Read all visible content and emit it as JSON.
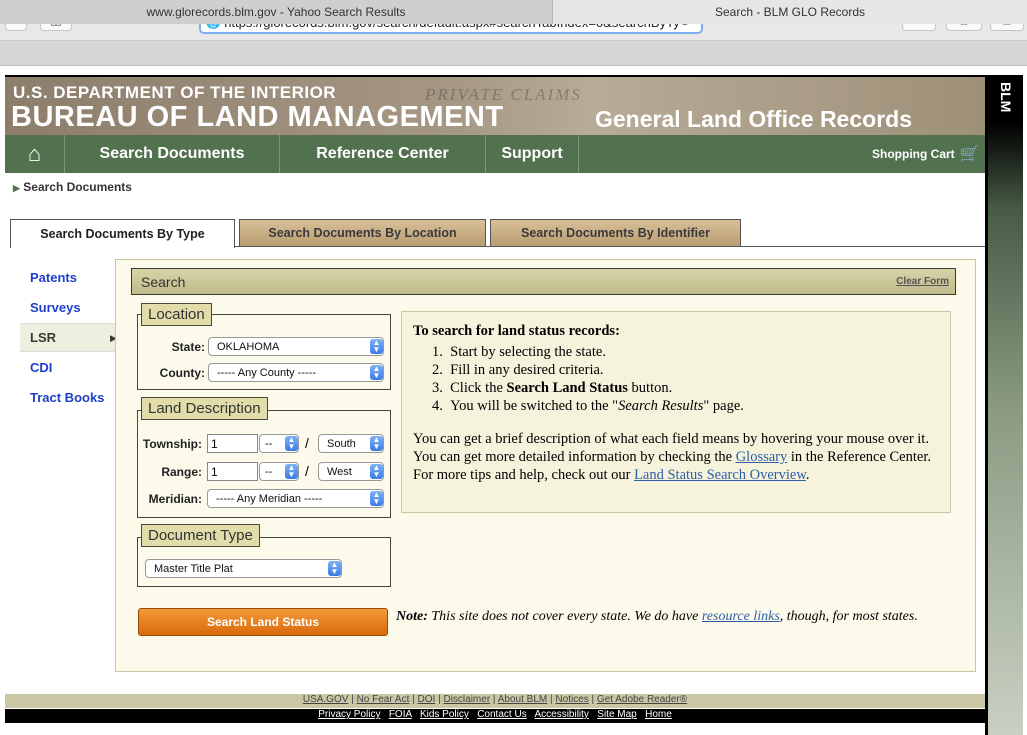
{
  "browser": {
    "url": "https://glorecords.blm.gov/search/default.aspx#searchTabIndex=0&searchByTy",
    "tabs": [
      "www.glorecords.blm.gov - Yahoo Search Results",
      "Search - BLM GLO Records"
    ]
  },
  "header": {
    "dept": "U.S. DEPARTMENT OF THE INTERIOR",
    "bureau": "BUREAU OF LAND MANAGEMENT",
    "deco": "PRIVATE CLAIMS",
    "glo": "General Land Office Records",
    "side": "BLM"
  },
  "nav": {
    "items": [
      "Search Documents",
      "Reference Center",
      "Support"
    ],
    "cart": "Shopping Cart"
  },
  "breadcrumb": "Search Documents",
  "search_tabs": [
    "Search Documents By Type",
    "Search Documents By Location",
    "Search Documents By Identifier"
  ],
  "sidebar": [
    "Patents",
    "Surveys",
    "LSR",
    "CDI",
    "Tract Books"
  ],
  "panel": {
    "title": "Search",
    "clear": "Clear Form",
    "location": {
      "legend": "Location",
      "state_label": "State:",
      "state_value": "OKLAHOMA",
      "county_label": "County:",
      "county_value": "----- Any County -----"
    },
    "land": {
      "legend": "Land Description",
      "township_label": "Township:",
      "township_value": "1",
      "township_dir": "--",
      "township_ns": "South",
      "range_label": "Range:",
      "range_value": "1",
      "range_dir": "--",
      "range_ew": "West",
      "slash": "/",
      "meridian_label": "Meridian:",
      "meridian_value": "----- Any Meridian -----"
    },
    "doctype": {
      "legend": "Document Type",
      "value": "Master Title Plat"
    },
    "button": "Search Land Status"
  },
  "info": {
    "heading": "To search for land status records:",
    "step1": "Start by selecting the state.",
    "step2": "Fill in any desired criteria.",
    "step3_a": "Click the ",
    "step3_b": "Search Land Status",
    "step3_c": " button.",
    "step4_a": "You will be switched to the \"",
    "step4_b": "Search Results",
    "step4_c": "\" page.",
    "para_a": "You can get a brief description of what each field means by hovering your mouse over it. You can get more detailed information by checking the ",
    "para_glossary": "Glossary",
    "para_b": " in the Reference Center. For more tips and help, check out our ",
    "para_link": "Land Status Search Overview",
    "para_c": "."
  },
  "note": {
    "label": "Note:",
    "text_a": " This site does not cover every state. We do have ",
    "link": "resource links",
    "text_b": ", though, for most states."
  },
  "footer": {
    "row1": [
      "USA.GOV",
      "No Fear Act",
      "DOI",
      "Disclaimer",
      "About BLM",
      "Notices",
      "Get Adobe Reader®"
    ],
    "row2": [
      "Privacy Policy",
      "FOIA",
      "Kids Policy",
      "Contact Us",
      "Accessibility",
      "Site Map",
      "Home"
    ]
  }
}
